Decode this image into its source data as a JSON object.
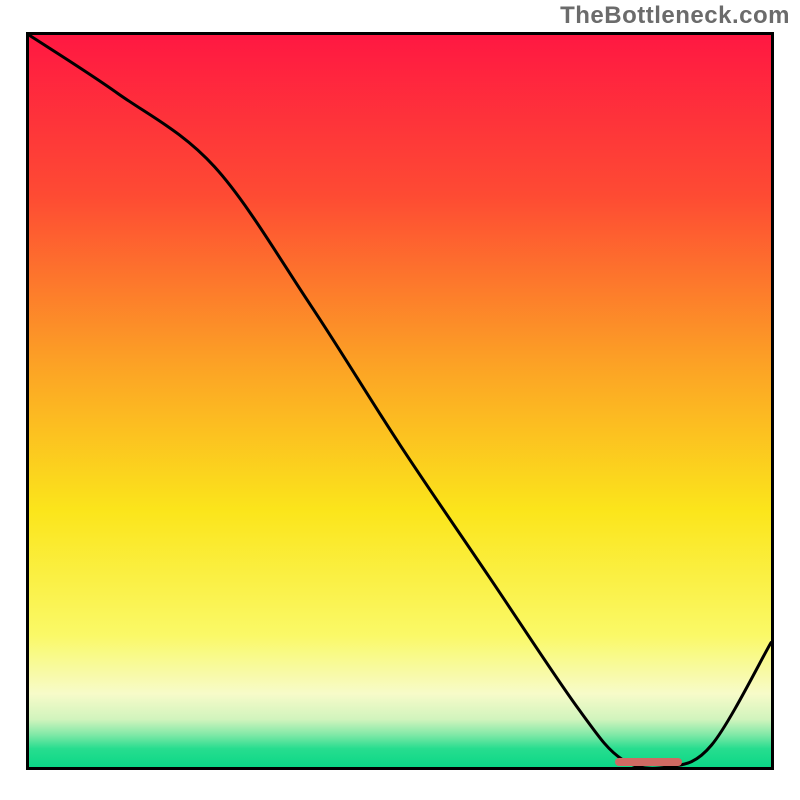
{
  "watermark": "TheBottleneck.com",
  "chart_data": {
    "type": "line",
    "title": "",
    "xlabel": "",
    "ylabel": "",
    "xlim": [
      0,
      100
    ],
    "ylim": [
      0,
      100
    ],
    "grid": false,
    "series": [
      {
        "name": "curve",
        "x": [
          0,
          12,
          25,
          38,
          50,
          62,
          74,
          80,
          86,
          92,
          100
        ],
        "values": [
          100,
          92,
          82,
          63,
          44,
          26,
          8,
          1,
          0,
          3,
          17
        ]
      }
    ],
    "annotations": [
      {
        "name": "optimum-marker",
        "x_range": [
          79,
          88
        ],
        "y": 0.7
      }
    ],
    "gradient_stops": [
      {
        "offset": 0.0,
        "color": "#ff1842"
      },
      {
        "offset": 0.22,
        "color": "#fe4b33"
      },
      {
        "offset": 0.45,
        "color": "#fca225"
      },
      {
        "offset": 0.65,
        "color": "#fbe51b"
      },
      {
        "offset": 0.82,
        "color": "#faf967"
      },
      {
        "offset": 0.9,
        "color": "#f7fbc9"
      },
      {
        "offset": 0.935,
        "color": "#d1f4bd"
      },
      {
        "offset": 0.955,
        "color": "#84e9a8"
      },
      {
        "offset": 0.975,
        "color": "#27dd8f"
      },
      {
        "offset": 1.0,
        "color": "#0bd886"
      }
    ]
  }
}
